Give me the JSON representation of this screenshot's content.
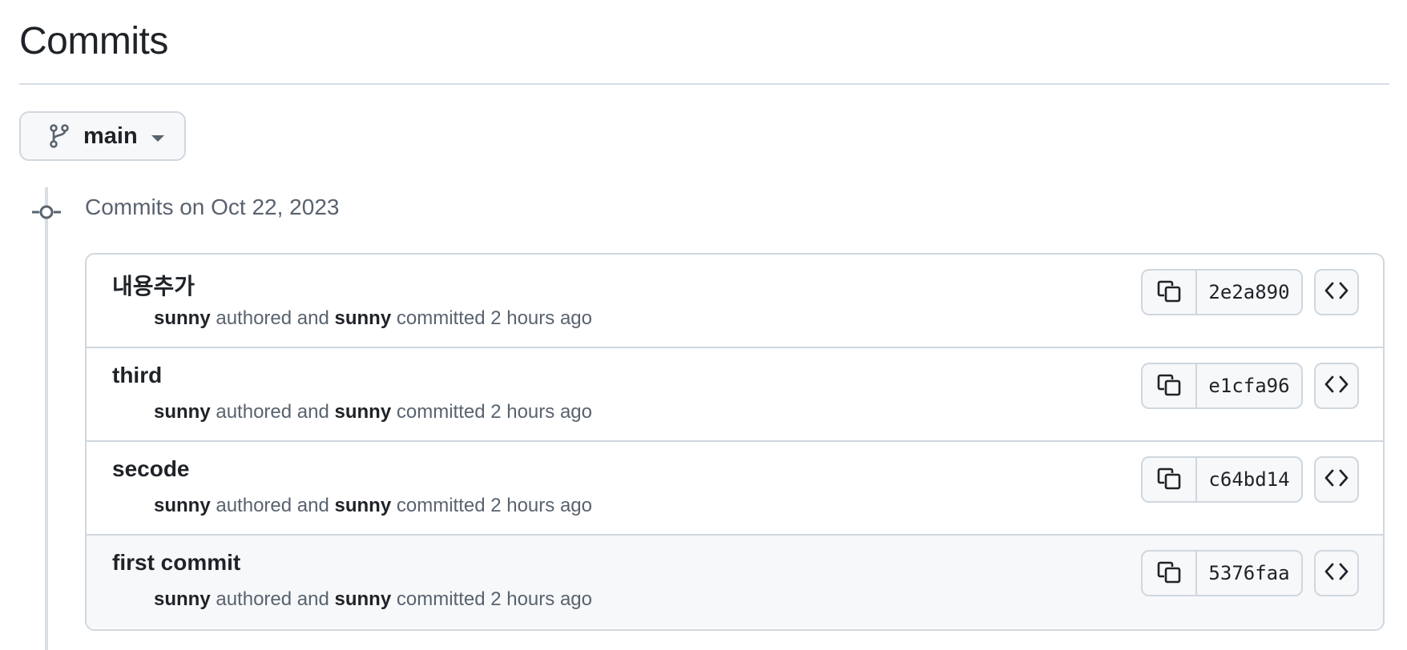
{
  "page": {
    "title": "Commits"
  },
  "branch": {
    "name": "main",
    "icon": "git-branch-icon",
    "dropdown_icon": "caret-down-icon"
  },
  "group": {
    "heading": "Commits on Oct 22, 2023",
    "icon": "git-commit-icon"
  },
  "commits": [
    {
      "message": "내용추가",
      "author": "sunny",
      "authored_text": "authored and",
      "committer": "sunny",
      "committed_text": "committed 2 hours ago",
      "sha": "2e2a890"
    },
    {
      "message": "third",
      "author": "sunny",
      "authored_text": "authored and",
      "committer": "sunny",
      "committed_text": "committed 2 hours ago",
      "sha": "e1cfa96"
    },
    {
      "message": "secode",
      "author": "sunny",
      "authored_text": "authored and",
      "committer": "sunny",
      "committed_text": "committed 2 hours ago",
      "sha": "c64bd14"
    },
    {
      "message": "first commit",
      "author": "sunny",
      "authored_text": "authored and",
      "committer": "sunny",
      "committed_text": "committed 2 hours ago",
      "sha": "5376faa"
    }
  ],
  "icons": {
    "copy": "copy-icon",
    "browse": "code-icon"
  },
  "colors": {
    "border": "#d0d7de",
    "muted_text": "#59636e",
    "text": "#1f2328",
    "button_bg": "#f6f8fa"
  }
}
